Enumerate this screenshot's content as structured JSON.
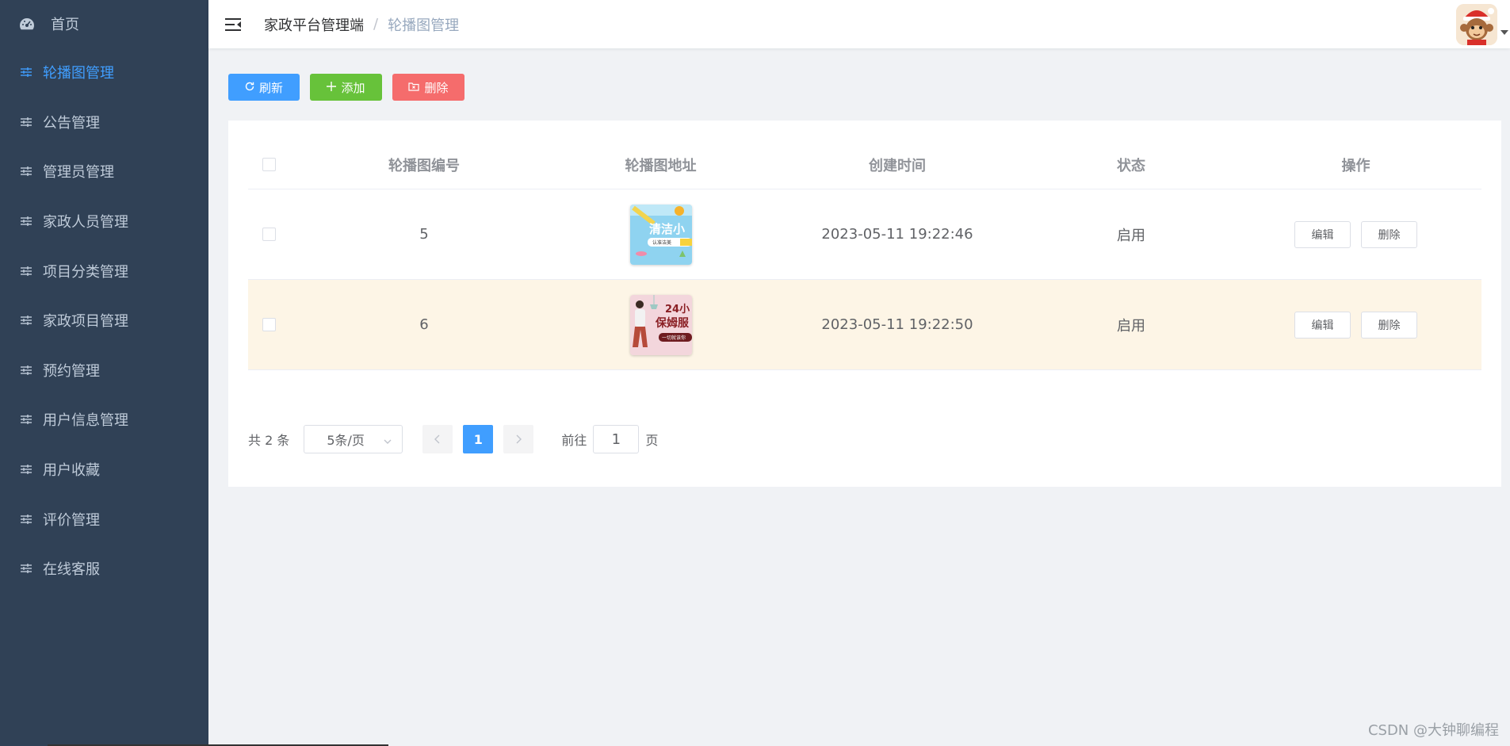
{
  "sidebar": {
    "items": [
      {
        "label": "首页",
        "icon": "dashboard-icon"
      },
      {
        "label": "轮播图管理",
        "icon": "sliders-icon",
        "active": true
      },
      {
        "label": "公告管理",
        "icon": "sliders-icon"
      },
      {
        "label": "管理员管理",
        "icon": "sliders-icon"
      },
      {
        "label": "家政人员管理",
        "icon": "sliders-icon"
      },
      {
        "label": "项目分类管理",
        "icon": "sliders-icon"
      },
      {
        "label": "家政项目管理",
        "icon": "sliders-icon"
      },
      {
        "label": "预约管理",
        "icon": "sliders-icon"
      },
      {
        "label": "用户信息管理",
        "icon": "sliders-icon"
      },
      {
        "label": "用户收藏",
        "icon": "sliders-icon"
      },
      {
        "label": "评价管理",
        "icon": "sliders-icon"
      },
      {
        "label": "在线客服",
        "icon": "sliders-icon"
      }
    ],
    "active_color": "#409eff",
    "bg_color": "#304156"
  },
  "header": {
    "breadcrumb_root": "家政平台管理端",
    "breadcrumb_sep": "/",
    "breadcrumb_current": "轮播图管理"
  },
  "toolbar": {
    "refresh_label": "刷新",
    "add_label": "添加",
    "delete_label": "删除"
  },
  "table": {
    "columns": [
      "轮播图编号",
      "轮播图地址",
      "创建时间",
      "状态",
      "操作"
    ],
    "rows": [
      {
        "id": "5",
        "created": "2023-05-11 19:22:46",
        "status": "启用",
        "edit": "编辑",
        "delete": "删除",
        "thumb_text": "清洁小",
        "thumb_sub": "认准洁美"
      },
      {
        "id": "6",
        "created": "2023-05-11 19:22:50",
        "status": "启用",
        "edit": "编辑",
        "delete": "删除",
        "thumb_text": "24小",
        "thumb_text2": "保姆服",
        "thumb_sub": "一切就该你"
      }
    ]
  },
  "pagination": {
    "total": "共 2 条",
    "page_size": "5条/页",
    "current_page": "1",
    "goto_prefix": "前往",
    "goto_value": "1",
    "goto_suffix": "页"
  },
  "watermark": "CSDN @大钟聊编程"
}
